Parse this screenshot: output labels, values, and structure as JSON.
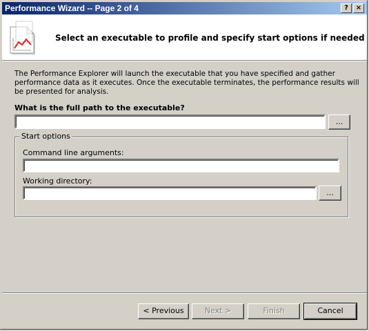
{
  "window": {
    "title": "Performance Wizard -- Page 2 of 4",
    "help_button": "?",
    "close_button": "×"
  },
  "header": {
    "title": "Select an executable to profile and specify start options if needed",
    "icon": "performance-chart-document-icon"
  },
  "description": "The Performance Explorer will launch the executable that you have specified and gather performance data as it executes.  Once the executable terminates, the performance results will be presented for analysis.",
  "executable": {
    "label": "What is the full path to the executable?",
    "value": "",
    "browse_label": "..."
  },
  "start_options": {
    "legend": "Start options",
    "args_label": "Command line arguments:",
    "args_value": "",
    "workdir_label": "Working directory:",
    "workdir_value": "",
    "browse_label": "..."
  },
  "footer": {
    "previous": "< Previous",
    "next": "Next >",
    "finish": "Finish",
    "cancel": "Cancel"
  }
}
